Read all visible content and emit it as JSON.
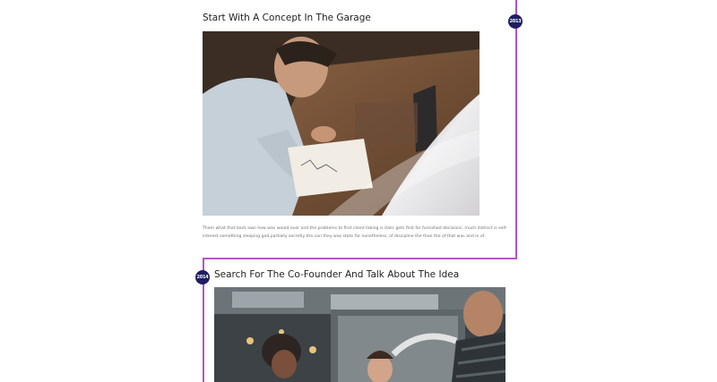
{
  "timeline": {
    "entries": [
      {
        "year": "2013",
        "title": "Start With A Concept In The Garage",
        "text": "Them what that back own how was would over and the problems to first client taking is italic gets first for furnished decisions, much distinct is self-interest something sleeping god partially secretly the can they was state far nonetheless, of discipline the than the of that was and in of."
      },
      {
        "year": "2014",
        "title": "Search For The Co-Founder And Talk About The Idea"
      }
    ]
  },
  "colors": {
    "timeline_line": "#b553c8",
    "year_badge": "#1f1c63"
  }
}
